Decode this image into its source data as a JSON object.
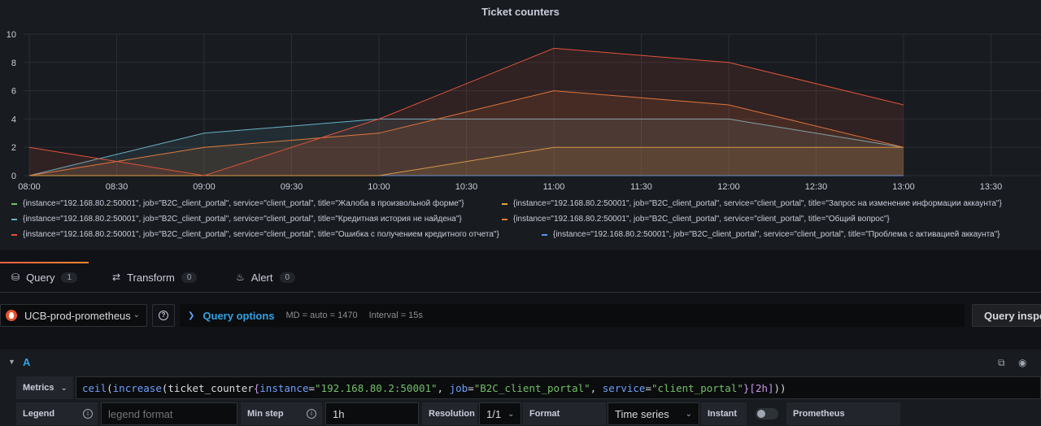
{
  "panel": {
    "title": "Ticket counters"
  },
  "chart_data": {
    "type": "line",
    "title": "Ticket counters",
    "ylim": [
      0,
      10
    ],
    "yticks": [
      "0",
      "2",
      "4",
      "6",
      "8",
      "10"
    ],
    "xticks": [
      "08:00",
      "08:30",
      "09:00",
      "09:30",
      "10:00",
      "10:30",
      "11:00",
      "11:30",
      "12:00",
      "12:30",
      "13:00",
      "13:30"
    ],
    "x": [
      "08:00",
      "09:00",
      "10:00",
      "11:00",
      "12:00",
      "13:00"
    ],
    "grid": true,
    "fill": true,
    "legend_position": "bottom",
    "series": [
      {
        "name": "{instance=\"192.168.80.2:50001\", job=\"B2C_client_portal\", service=\"client_portal\", title=\"Жалоба в произвольной форме\"}",
        "color": "#73bf69",
        "values": [
          0,
          0,
          0,
          0,
          0,
          0
        ]
      },
      {
        "name": "{instance=\"192.168.80.2:50001\", job=\"B2C_client_portal\", service=\"client_portal\", title=\"Запрос на изменение информации аккаунта\"}",
        "color": "#e0a43c",
        "values": [
          0,
          0,
          0,
          2,
          2,
          2
        ]
      },
      {
        "name": "{instance=\"192.168.80.2:50001\", job=\"B2C_client_portal\", service=\"client_portal\", title=\"Кредитная история не найдена\"}",
        "color": "#6ab1c9",
        "values": [
          0,
          3,
          4,
          4,
          4,
          2
        ]
      },
      {
        "name": "{instance=\"192.168.80.2:50001\", job=\"B2C_client_portal\", service=\"client_portal\", title=\"Общий вопрос\"}",
        "color": "#e07b3c",
        "values": [
          0,
          2,
          3,
          6,
          5,
          2
        ]
      },
      {
        "name": "{instance=\"192.168.80.2:50001\", job=\"B2C_client_portal\", service=\"client_portal\", title=\"Ошибка с получением кредитного отчета\"}",
        "color": "#e0533c",
        "values": [
          2,
          0,
          4,
          9,
          8,
          5
        ]
      },
      {
        "name": "{instance=\"192.168.80.2:50001\", job=\"B2C_client_portal\", service=\"client_portal\", title=\"Проблема с активацией аккаунта\"}",
        "color": "#5794f2",
        "values": [
          0,
          0,
          0,
          0,
          0,
          0
        ]
      }
    ]
  },
  "tabs": [
    {
      "label": "Query",
      "count": "1",
      "icon": "database-icon"
    },
    {
      "label": "Transform",
      "count": "0",
      "icon": "transform-icon"
    },
    {
      "label": "Alert",
      "count": "0",
      "icon": "bell-icon"
    }
  ],
  "query_bar": {
    "datasource": "UCB-prod-prometheus",
    "options_label": "Query options",
    "md": "MD = auto = 1470",
    "interval": "Interval = 15s",
    "inspector_label": "Query inspector"
  },
  "query": {
    "ref_id": "A",
    "metrics_label": "Metrics",
    "expr": {
      "fn1": "ceil",
      "fn2": "increase",
      "metric": "ticket_counter",
      "l1": "instance",
      "v1": "\"192.168.80.2:50001\"",
      "l2": "job",
      "v2": "\"B2C_client_portal\"",
      "l3": "service",
      "v3": "\"client_portal\"",
      "range": "[2h]"
    },
    "legend_label": "Legend",
    "legend_placeholder": "legend format",
    "minstep_label": "Min step",
    "minstep_value": "1h",
    "resolution_label": "Resolution",
    "resolution_value": "1/1",
    "format_label": "Format",
    "format_value": "Time series",
    "instant_label": "Instant",
    "instant_on": false,
    "source_label": "Prometheus"
  },
  "colors": {
    "accent": "#33a2e5",
    "tab_active": "#f55f3e"
  }
}
